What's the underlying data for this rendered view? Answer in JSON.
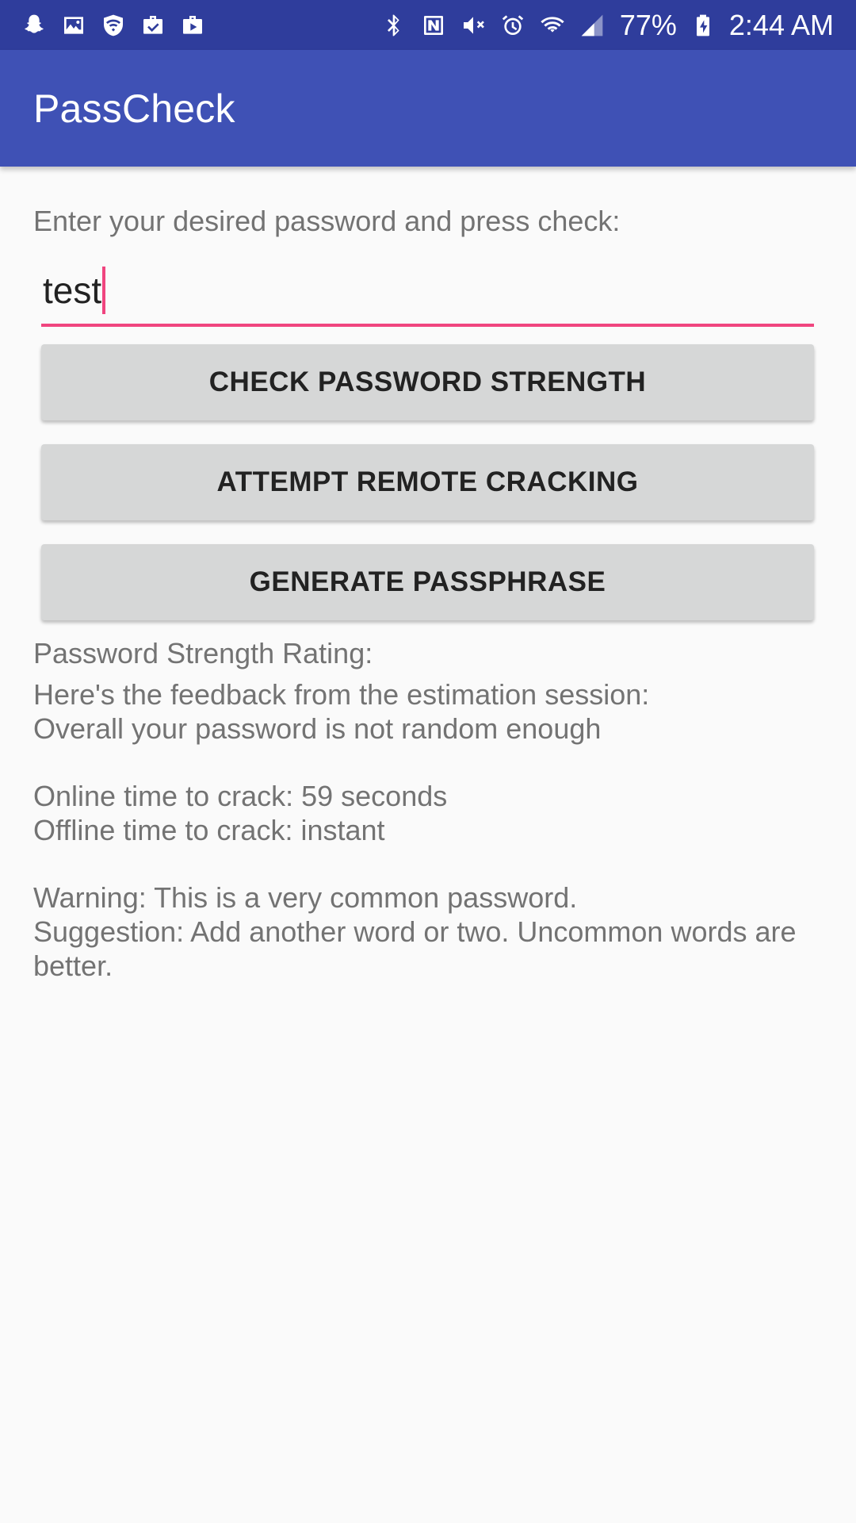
{
  "status_bar": {
    "left_icons": [
      "snapchat-icon",
      "image-icon",
      "shield-icon",
      "briefcase-check-icon",
      "play-bag-icon"
    ],
    "right_icons": [
      "bluetooth-icon",
      "nfc-icon",
      "mute-icon",
      "alarm-icon",
      "wifi-icon",
      "signal-icon",
      "battery-charging-icon"
    ],
    "battery": "77%",
    "time": "2:44 AM"
  },
  "app_bar": {
    "title": "PassCheck"
  },
  "main": {
    "prompt": "Enter your desired password and press check:",
    "password_value": "test",
    "buttons": {
      "check": "CHECK PASSWORD STRENGTH",
      "attempt": "ATTEMPT REMOTE CRACKING",
      "generate": "GENERATE PASSPHRASE"
    },
    "results": {
      "rating_label": "Password Strength Rating:",
      "feedback_heading": "Here's the feedback from the estimation session:",
      "feedback_line": "Overall your password is not random enough",
      "online": "Online time to crack: 59 seconds",
      "offline": "Offline time to crack: instant",
      "warning": "Warning: This is a very common password.",
      "suggestion": "Suggestion: Add another word or two. Uncommon words are better."
    }
  },
  "colors": {
    "status_bar": "#2f3d9c",
    "app_bar": "#3f51b5",
    "accent": "#f0457f",
    "button": "#d6d7d7",
    "background": "#fafafa"
  }
}
